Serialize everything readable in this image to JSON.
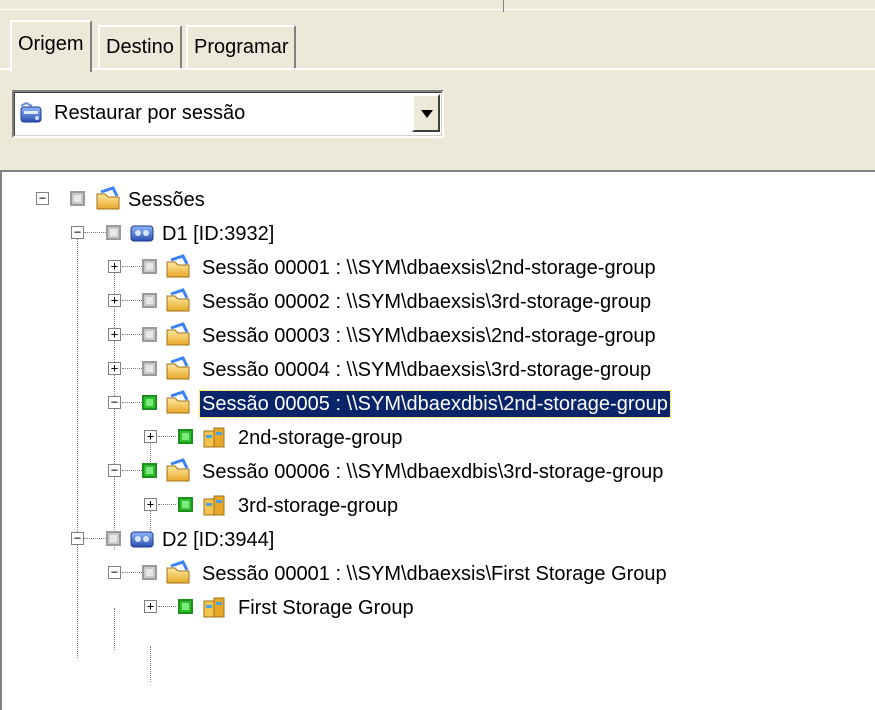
{
  "tabs": [
    {
      "label": "Origem"
    },
    {
      "label": "Destino"
    },
    {
      "label": "Programar"
    }
  ],
  "restore_mode": {
    "selected": "Restaurar por sessão",
    "icon": "restore-drive-icon"
  },
  "tree": {
    "root": {
      "label": "Sessões",
      "icon": "sessions-folder-icon",
      "expander": "−"
    },
    "rows": [
      {
        "label": "D1 [ID:3932]",
        "icon": "tape-media-icon",
        "expander": "−"
      },
      {
        "label": "Sessão 00001 : \\\\SYM\\dbaexsis\\2nd-storage-group",
        "icon": "session-folder-icon",
        "expander": "+"
      },
      {
        "label": "Sessão 00002 : \\\\SYM\\dbaexsis\\3rd-storage-group",
        "icon": "session-folder-icon",
        "expander": "+"
      },
      {
        "label": "Sessão 00003 : \\\\SYM\\dbaexsis\\2nd-storage-group",
        "icon": "session-folder-icon",
        "expander": "+"
      },
      {
        "label": "Sessão 00004 : \\\\SYM\\dbaexsis\\3rd-storage-group",
        "icon": "session-folder-icon",
        "expander": "+"
      },
      {
        "label": "Sessão 00005 : \\\\SYM\\dbaexdbis\\2nd-storage-group",
        "icon": "session-folder-icon",
        "expander": "−",
        "selected": true
      },
      {
        "label": "2nd-storage-group",
        "icon": "storage-group-icon",
        "expander": "+"
      },
      {
        "label": "Sessão 00006 : \\\\SYM\\dbaexdbis\\3rd-storage-group",
        "icon": "session-folder-icon",
        "expander": "−"
      },
      {
        "label": "3rd-storage-group",
        "icon": "storage-group-icon",
        "expander": "+"
      },
      {
        "label": "D2 [ID:3944]",
        "icon": "tape-media-icon",
        "expander": "−"
      },
      {
        "label": "Sessão 00001 : \\\\SYM\\dbaexsis\\First Storage Group",
        "icon": "session-folder-icon",
        "expander": "−"
      },
      {
        "label": "First Storage Group",
        "icon": "storage-group-icon",
        "expander": "+"
      }
    ]
  },
  "colors": {
    "selection_bg": "#0a246a",
    "checked_green": "#2fbf2f",
    "window_bg": "#ece9d8"
  }
}
